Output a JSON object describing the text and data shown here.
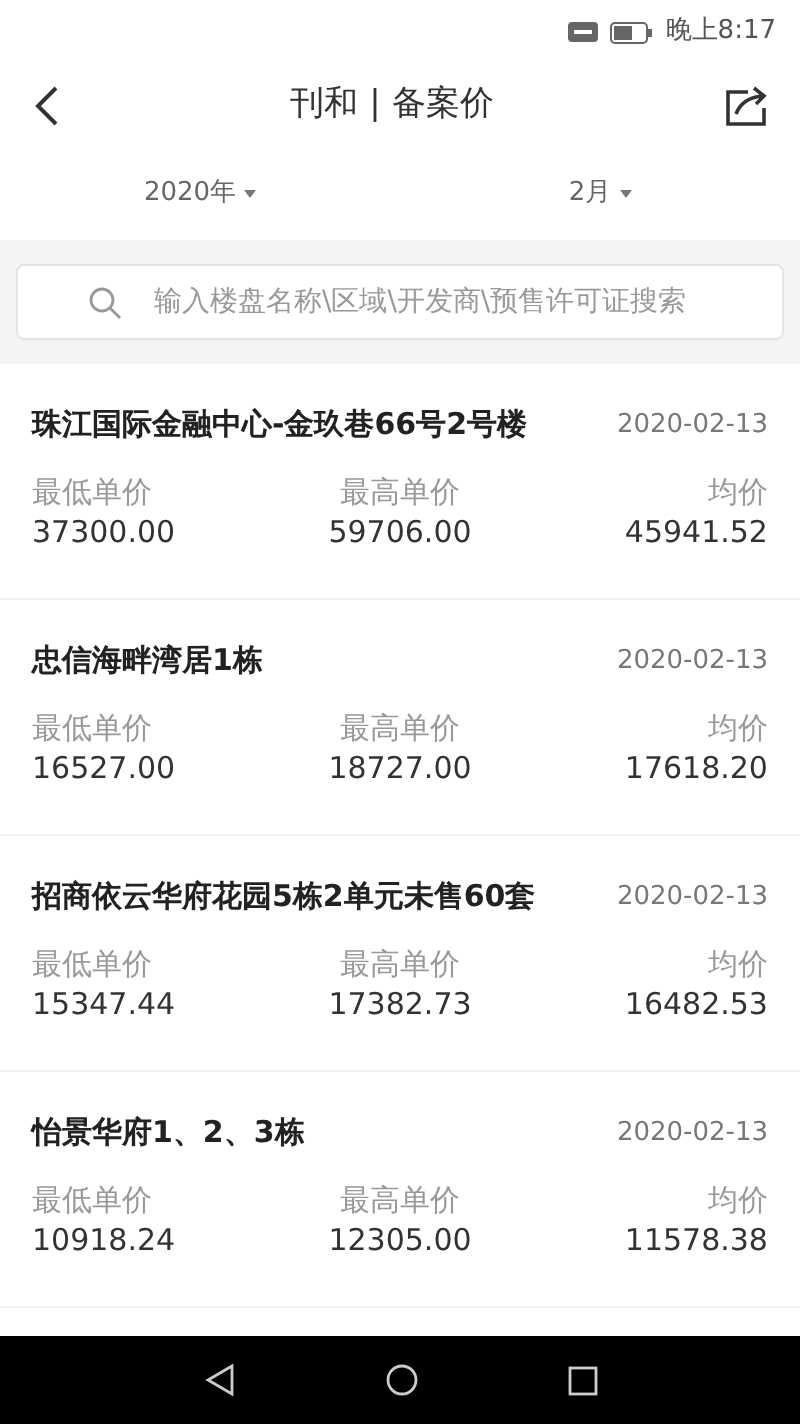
{
  "status_bar": {
    "time": "晚上8:17"
  },
  "header": {
    "title": "刊和 | 备案价"
  },
  "filters": [
    {
      "label": "2020年"
    },
    {
      "label": "2月"
    }
  ],
  "search": {
    "placeholder": "输入楼盘名称\\区域\\开发商\\预售许可证搜索"
  },
  "records": [
    {
      "name": "珠江国际金融中心-金玖巷66号2号楼",
      "date": "2020-02-13",
      "min_label": "最低单价",
      "min": "37300.00",
      "max_label": "最高单价",
      "max": "59706.00",
      "avg_label": "均价",
      "avg": "45941.52"
    },
    {
      "name": "忠信海畔湾居1栋",
      "date": "2020-02-13",
      "min_label": "最低单价",
      "min": "16527.00",
      "max_label": "最高单价",
      "max": "18727.00",
      "avg_label": "均价",
      "avg": "17618.20"
    },
    {
      "name": "招商依云华府花园5栋2单元未售60套",
      "date": "2020-02-13",
      "min_label": "最低单价",
      "min": "15347.44",
      "max_label": "最高单价",
      "max": "17382.73",
      "avg_label": "均价",
      "avg": "16482.53"
    },
    {
      "name": "怡景华府1、2、3栋",
      "date": "2020-02-13",
      "min_label": "最低单价",
      "min": "10918.24",
      "max_label": "最高单价",
      "max": "12305.00",
      "avg_label": "均价",
      "avg": "11578.38"
    }
  ]
}
